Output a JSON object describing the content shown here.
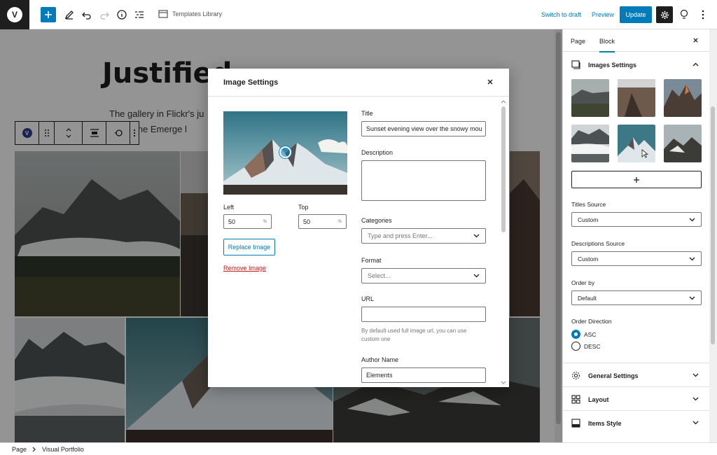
{
  "topbar": {
    "logo_letter": "V",
    "template_library": "Templates Library",
    "switch_to_draft": "Switch to draft",
    "preview": "Preview",
    "update": "Update"
  },
  "editor": {
    "page_title": "Justified",
    "intro_line1": "The gallery in Flickr's ju",
    "intro_line2": "te. The Emerge l",
    "block_icon_letter": "V"
  },
  "modal": {
    "title": "Image Settings",
    "left_label": "Left",
    "left_value": "50",
    "top_label": "Top",
    "top_value": "50",
    "unit": "%",
    "replace_image": "Replace Image",
    "remove_image": "Remove Image",
    "title_label": "Title",
    "title_value": "Sunset evening view over the snowy mou",
    "description_label": "Description",
    "description_value": "",
    "categories_label": "Categories",
    "categories_placeholder": "Type and press Enter...",
    "format_label": "Format",
    "format_placeholder": "Select...",
    "url_label": "URL",
    "url_value": "",
    "url_help": "By default used full image url, you can use custom one",
    "author_label": "Author Name",
    "author_value": "Elements"
  },
  "sidebar": {
    "tabs": [
      "Page",
      "Block"
    ],
    "active_tab": "Block",
    "images_settings": "Images Settings",
    "titles_source_label": "Titles Source",
    "titles_source_value": "Custom",
    "descriptions_source_label": "Descriptions Source",
    "descriptions_source_value": "Custom",
    "order_by_label": "Order by",
    "order_by_value": "Default",
    "order_direction_label": "Order Direction",
    "order_options": [
      "ASC",
      "DESC"
    ],
    "order_selected": "ASC",
    "general_settings": "General Settings",
    "layout": "Layout",
    "items_style": "Items Style"
  },
  "footer": {
    "crumbs": [
      "Page",
      "Visual Portfolio"
    ]
  },
  "colors": {
    "accent": "#007cba",
    "danger": "#cc1818",
    "dark": "#1e1e1e"
  }
}
